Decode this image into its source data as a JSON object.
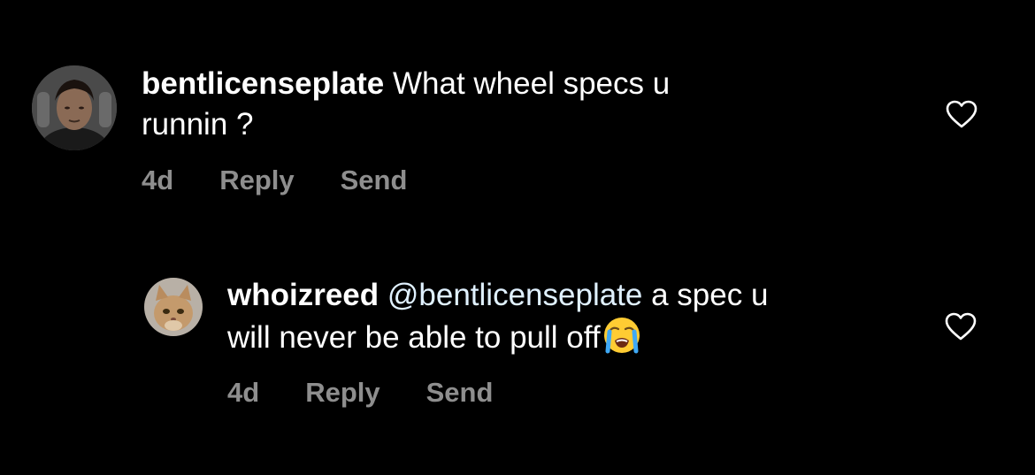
{
  "comments": [
    {
      "username": "bentlicenseplate",
      "text_line1": " What wheel specs u",
      "text_line2": "runnin ?",
      "time": "4d",
      "reply_label": "Reply",
      "send_label": "Send",
      "avatar_icon": "user-avatar-photo",
      "like_icon": "heart-outline-icon"
    },
    {
      "username": "whoizreed",
      "mention": "@bentlicenseplate",
      "text_line1": " a spec u",
      "text_line2": "will never be able to pull off",
      "emoji": "loudly-crying-face-emoji",
      "time": "4d",
      "reply_label": "Reply",
      "send_label": "Send",
      "avatar_icon": "cat-avatar-photo",
      "like_icon": "heart-outline-icon"
    }
  ],
  "colors": {
    "background": "#000000",
    "text": "#ffffff",
    "meta": "#8e8e8e",
    "mention": "#e0f1ff"
  }
}
